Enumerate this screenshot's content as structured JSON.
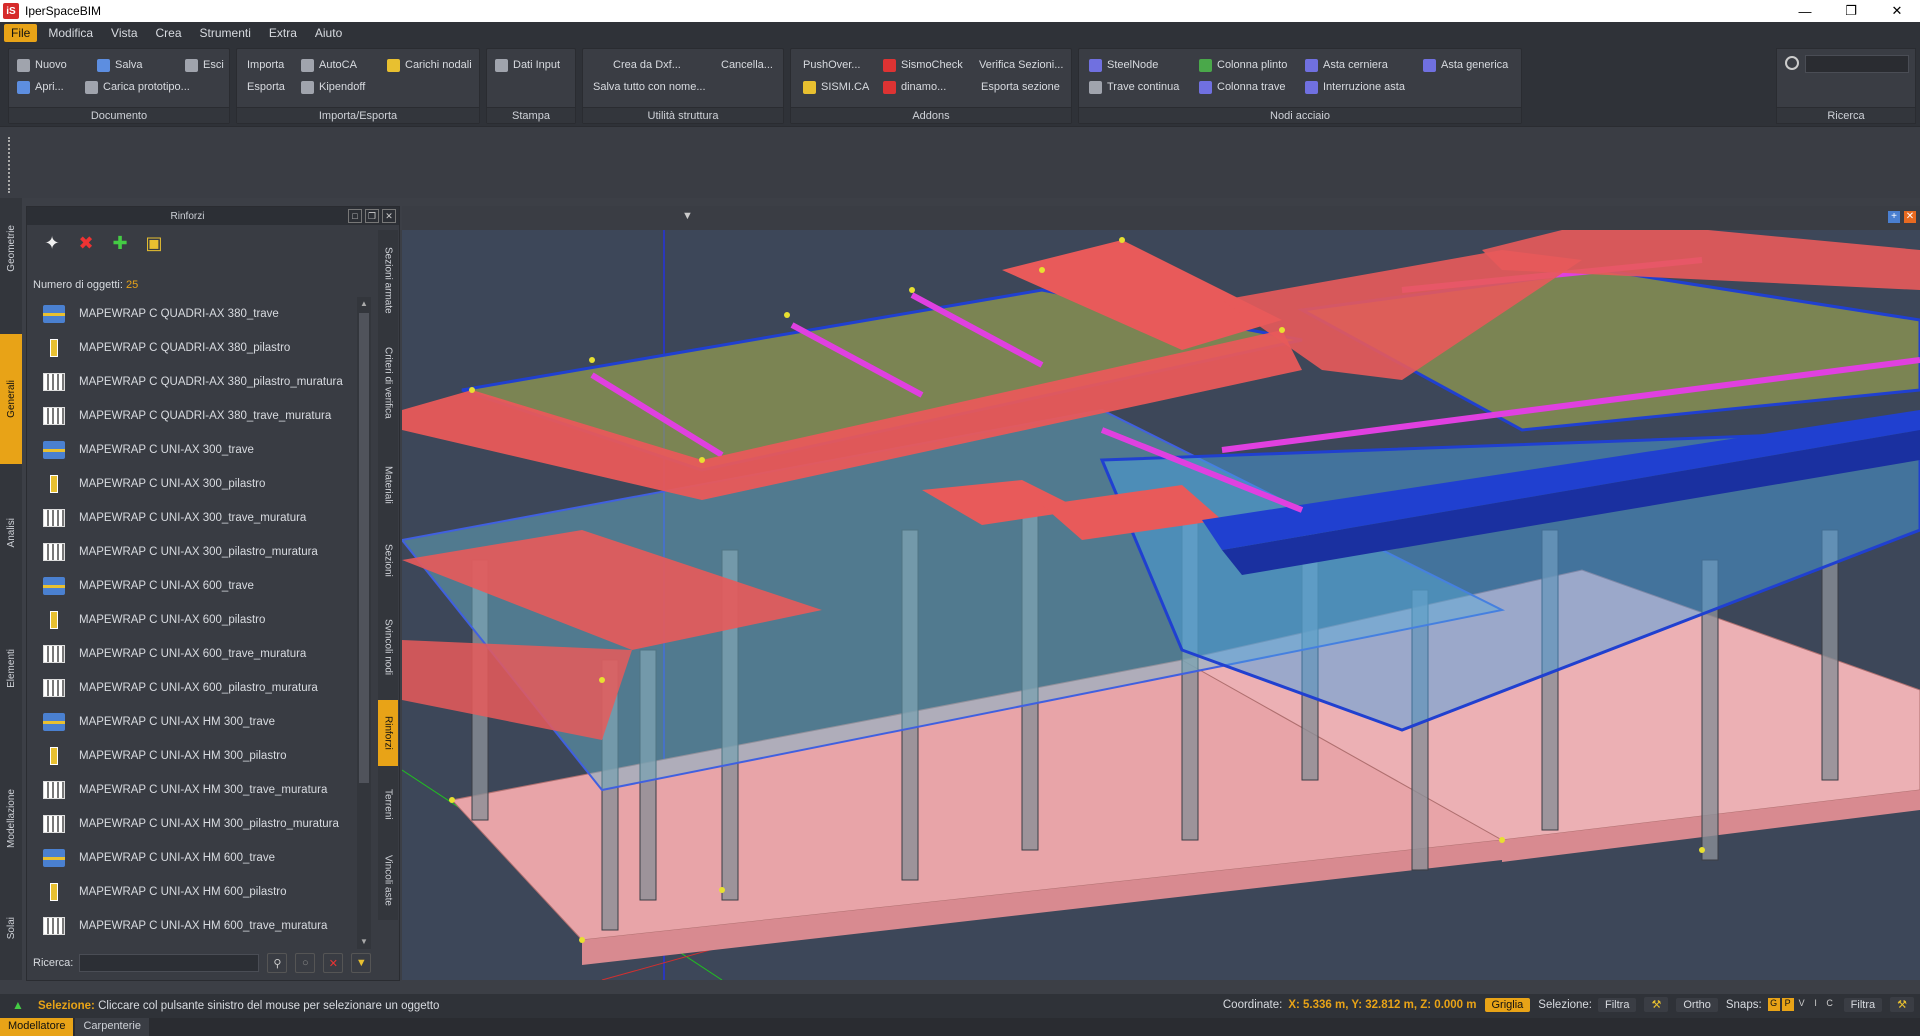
{
  "window": {
    "title": "IperSpaceBIM",
    "logo": "iS"
  },
  "menu": [
    "File",
    "Modifica",
    "Vista",
    "Crea",
    "Strumenti",
    "Extra",
    "Aiuto"
  ],
  "ribbon": {
    "documento": {
      "title": "Documento",
      "nuovo": "Nuovo",
      "salva": "Salva",
      "esci": "Esci",
      "apri": "Apri...",
      "carica": "Carica prototipo..."
    },
    "importa": {
      "title": "Importa/Esporta",
      "importa": "Importa",
      "autoca": "AutoCA",
      "carichi": "Carichi nodali",
      "esporta": "Esporta",
      "kipendoff": "Kipendoff"
    },
    "stampa": {
      "title": "Stampa",
      "dati": "Dati Input"
    },
    "utilita": {
      "title": "Utilità struttura",
      "crea": "Crea da Dxf...",
      "cancella": "Cancella...",
      "salva": "Salva tutto con nome..."
    },
    "addons": {
      "title": "Addons",
      "pushover": "PushOver...",
      "sismocheck": "SismoCheck",
      "verifica": "Verifica Sezioni...",
      "sismica": "SISMI.CA",
      "dinamo": "dinamo...",
      "esporta": "Esporta sezione"
    },
    "nodi": {
      "title": "Nodi acciaio",
      "steelnode": "SteelNode",
      "colonna_plinto": "Colonna plinto",
      "asta_cerniera": "Asta cerniera",
      "asta_generica": "Asta generica",
      "trave_continua": "Trave continua",
      "colonna_trave": "Colonna trave",
      "interruzione": "Interruzione asta"
    },
    "ricerca": {
      "title": "Ricerca"
    }
  },
  "left_tabs": [
    "Geometrie",
    "Generali",
    "Analisi",
    "Elementi",
    "Modellazione",
    "Solai"
  ],
  "panel": {
    "title": "Rinforzi",
    "count_label": "Numero di oggetti:",
    "count": "25",
    "search_label": "Ricerca:",
    "items": [
      {
        "label": "MAPEWRAP C QUADRI-AX 380_trave",
        "kind": "trave"
      },
      {
        "label": "MAPEWRAP C QUADRI-AX 380_pilastro",
        "kind": "pilastro"
      },
      {
        "label": "MAPEWRAP C QUADRI-AX 380_pilastro_muratura",
        "kind": "muratura"
      },
      {
        "label": "MAPEWRAP C QUADRI-AX 380_trave_muratura",
        "kind": "muratura"
      },
      {
        "label": "MAPEWRAP C UNI-AX 300_trave",
        "kind": "trave"
      },
      {
        "label": "MAPEWRAP C UNI-AX 300_pilastro",
        "kind": "pilastro"
      },
      {
        "label": "MAPEWRAP C UNI-AX 300_trave_muratura",
        "kind": "muratura"
      },
      {
        "label": "MAPEWRAP C UNI-AX 300_pilastro_muratura",
        "kind": "muratura"
      },
      {
        "label": "MAPEWRAP C UNI-AX 600_trave",
        "kind": "trave"
      },
      {
        "label": "MAPEWRAP C UNI-AX 600_pilastro",
        "kind": "pilastro"
      },
      {
        "label": "MAPEWRAP C UNI-AX 600_trave_muratura",
        "kind": "muratura"
      },
      {
        "label": "MAPEWRAP C UNI-AX 600_pilastro_muratura",
        "kind": "muratura"
      },
      {
        "label": "MAPEWRAP C UNI-AX HM 300_trave",
        "kind": "trave"
      },
      {
        "label": "MAPEWRAP C UNI-AX HM 300_pilastro",
        "kind": "pilastro"
      },
      {
        "label": "MAPEWRAP C UNI-AX HM 300_trave_muratura",
        "kind": "muratura"
      },
      {
        "label": "MAPEWRAP C UNI-AX HM 300_pilastro_muratura",
        "kind": "muratura"
      },
      {
        "label": "MAPEWRAP C UNI-AX HM 600_trave",
        "kind": "trave"
      },
      {
        "label": "MAPEWRAP C UNI-AX HM 600_pilastro",
        "kind": "pilastro"
      },
      {
        "label": "MAPEWRAP C UNI-AX HM 600_trave_muratura",
        "kind": "muratura"
      }
    ]
  },
  "side_tabs": [
    "Sezioni armate",
    "Criteri di verifica",
    "Materiali",
    "Sezioni",
    "Svincoli nodi",
    "Rinforzi",
    "Terreni",
    "Vincoli aste"
  ],
  "status": {
    "label": "Selezione:",
    "message": "Cliccare col pulsante sinistro del mouse per selezionare un oggetto",
    "coord_label": "Coordinate:",
    "coord_value": "X: 5.336 m, Y: 32.812 m, Z: 0.000 m",
    "griglia": "Griglia",
    "selezione": "Selezione:",
    "filtra": "Filtra",
    "ortho": "Ortho",
    "snaps": "Snaps:",
    "snap_g": "G",
    "snap_p": "P",
    "snap_v": "V",
    "snap_i": "I",
    "snap_c": "C",
    "filtra2": "Filtra"
  },
  "bottom_tabs": [
    "Modellatore",
    "Carpenterie"
  ],
  "colors": {
    "accent": "#e8a317",
    "slab": "#e85a5a",
    "beam": "#2040d0",
    "foundation": "#e8a4a8"
  }
}
